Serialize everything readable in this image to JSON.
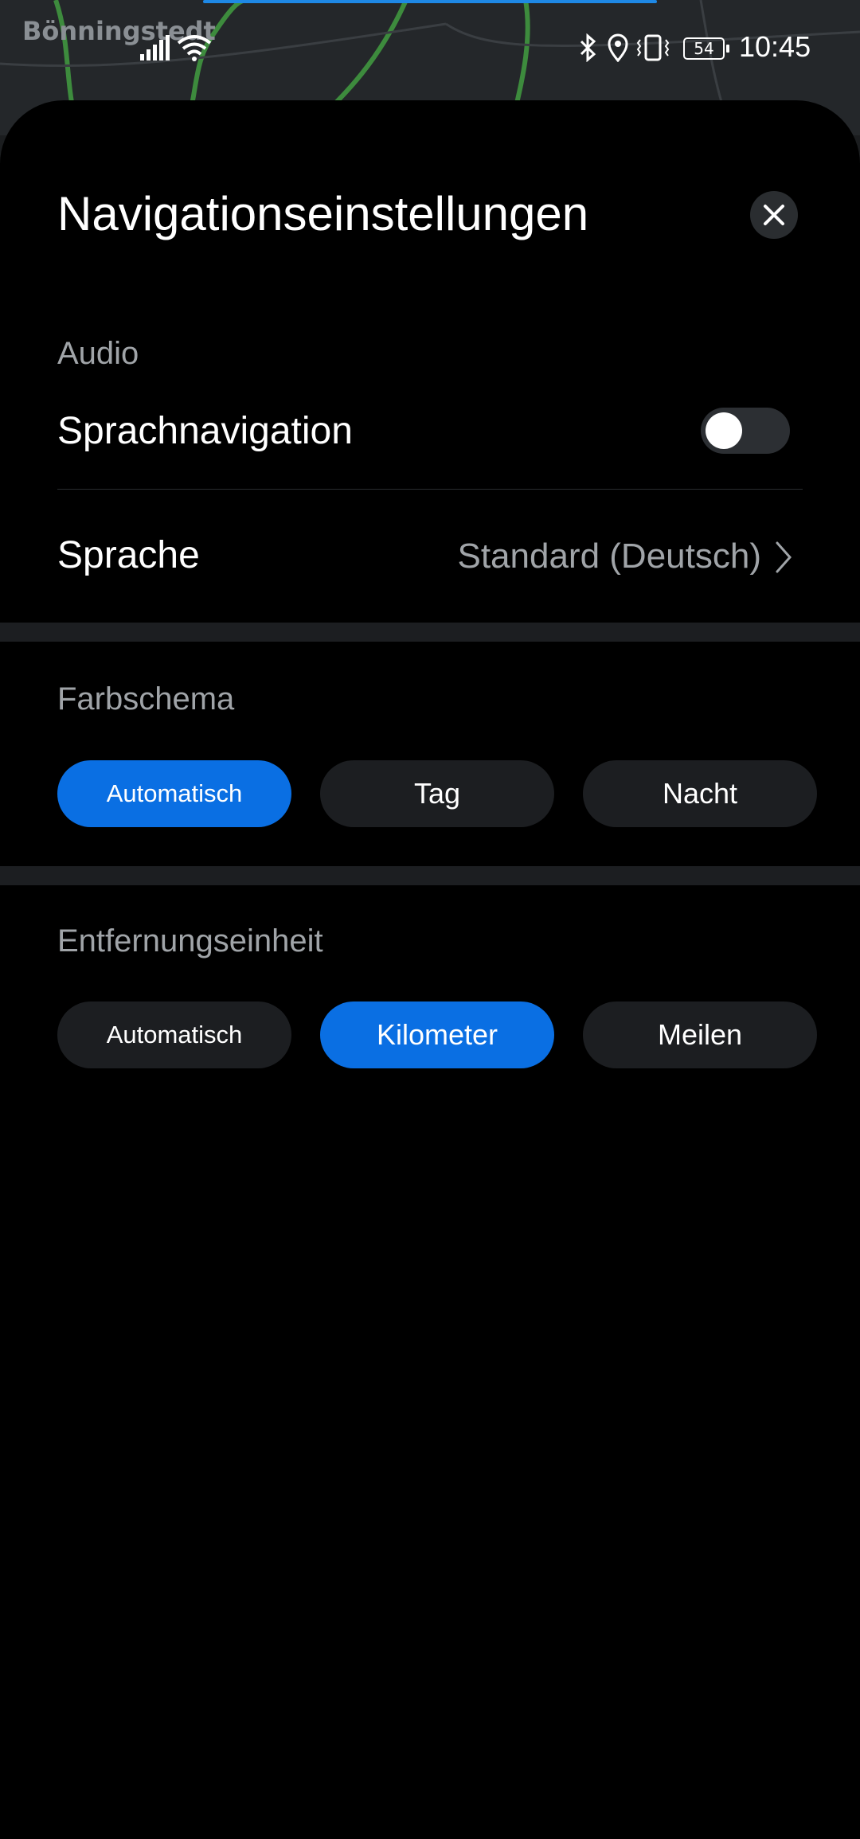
{
  "map": {
    "place_label": "Bönningstedt"
  },
  "status_bar": {
    "time": "10:45",
    "battery": "54",
    "icons": [
      "signal-icon",
      "wifi-icon",
      "bluetooth-icon",
      "location-icon",
      "vibrate-icon",
      "battery-icon"
    ]
  },
  "sheet": {
    "title": "Navigationseinstellungen",
    "close_icon": "close-icon"
  },
  "audio": {
    "section_label": "Audio",
    "voice_navigation_label": "Sprachnavigation",
    "voice_navigation_enabled": false,
    "language_label": "Sprache",
    "language_value": "Standard (Deutsch)"
  },
  "color_scheme": {
    "section_label": "Farbschema",
    "options": [
      "Automatisch",
      "Tag",
      "Nacht"
    ],
    "selected": "Automatisch"
  },
  "distance_unit": {
    "section_label": "Entfernungseinheit",
    "options": [
      "Automatisch",
      "Kilometer",
      "Meilen"
    ],
    "selected": "Kilometer"
  },
  "colors": {
    "accent": "#0a6fe3",
    "sheet_background": "#000000",
    "button_background": "#1c1e21",
    "secondary_text": "#a0a4a8"
  }
}
